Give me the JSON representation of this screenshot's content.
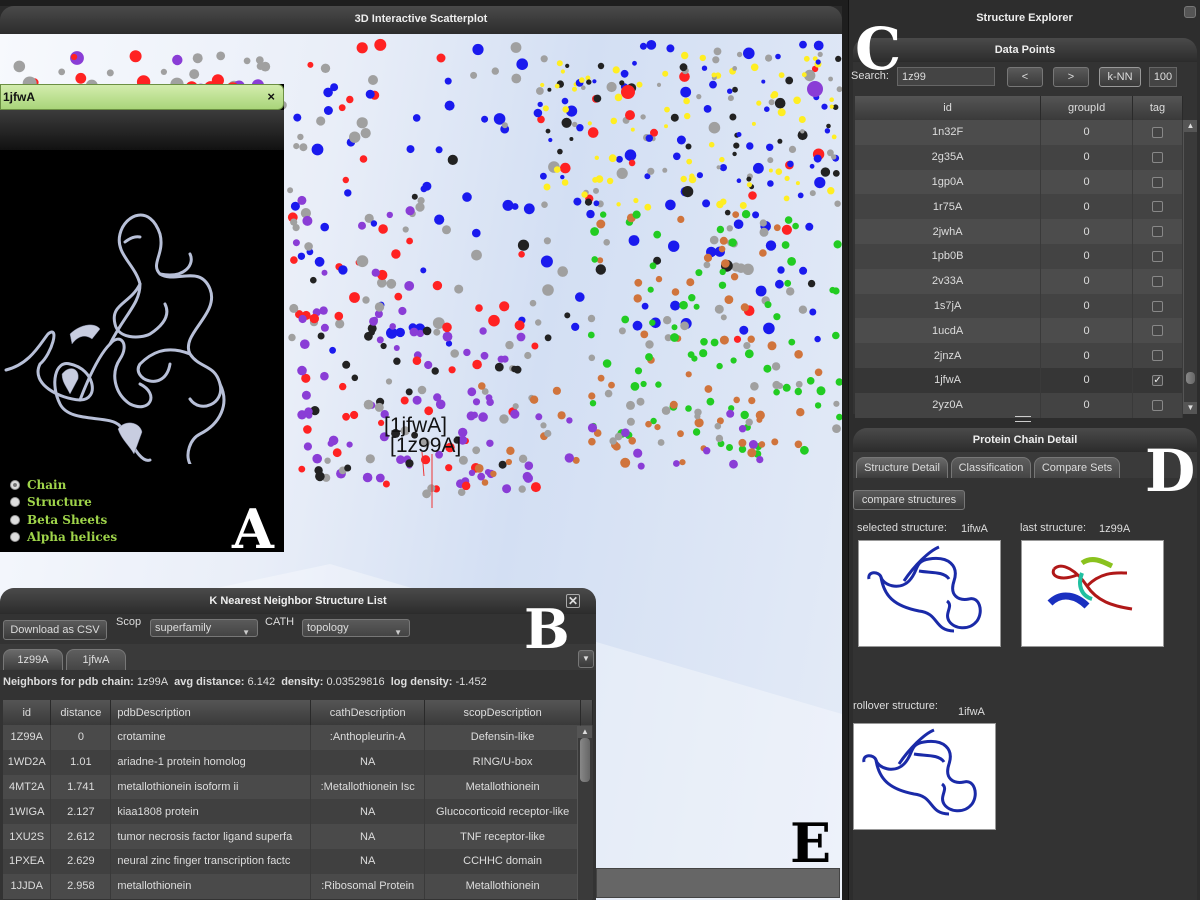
{
  "scatterplot": {
    "title": "3D Interactive Scatterplot",
    "labels": [
      "[1jfwA]",
      "[1z99A]"
    ],
    "point_colors": {
      "red": "#ff2222",
      "blue": "#1a1aee",
      "grey": "#a0a0a0",
      "purple": "#8a3dd6",
      "yellow": "#ffee22",
      "green": "#22cc22",
      "black": "#222222",
      "orange": "#d0743c"
    },
    "panel_letter": "E"
  },
  "viewer": {
    "title": "1jfwA",
    "close": "×",
    "options": [
      "Chain",
      "Structure",
      "Beta Sheets",
      "Alpha helices"
    ],
    "selected_option": "Chain",
    "panel_letter": "A"
  },
  "knn": {
    "title": "K Nearest Neighbor Structure List",
    "close": "✕",
    "download_label": "Download as CSV",
    "scop_label": "Scop",
    "scop_value": "superfamily",
    "cath_label": "CATH",
    "cath_value": "topology",
    "tabs": [
      "1z99A",
      "1jfwA"
    ],
    "info": {
      "neighbors_label": "Neighbors for pdb chain:",
      "chain": "1z99A",
      "avg_label": "avg distance:",
      "avg": "6.142",
      "density_label": "density:",
      "density": "0.03529816",
      "logdensity_label": "log density:",
      "logdensity": "-1.452"
    },
    "columns": [
      "id",
      "distance",
      "pdbDescription",
      "cathDescription",
      "scopDescription"
    ],
    "rows": [
      [
        "1Z99A",
        "0",
        "crotamine",
        ":Anthopleurin-A",
        "Defensin-like"
      ],
      [
        "1WD2A",
        "1.01",
        "ariadne-1 protein homolog",
        "NA",
        "RING/U-box"
      ],
      [
        "4MT2A",
        "1.741",
        "metallothionein isoform ii",
        ":Metallothionein Isc",
        "Metallothionein"
      ],
      [
        "1WIGA",
        "2.127",
        "kiaa1808 protein",
        "NA",
        "Glucocorticoid receptor-like"
      ],
      [
        "1XU2S",
        "2.612",
        "tumor necrosis factor ligand superfa",
        "NA",
        "TNF receptor-like"
      ],
      [
        "1PXEA",
        "2.629",
        "neural zinc finger transcription factc",
        "NA",
        "CCHHC domain"
      ],
      [
        "1JJDA",
        "2.958",
        "metallothionein",
        ":Ribosomal Protein",
        "Metallothionein"
      ]
    ],
    "panel_letter": "B"
  },
  "explorer": {
    "title": "Structure Explorer",
    "data_points": {
      "title": "Data Points",
      "search_label": "Search:",
      "search_value": "1z99",
      "prev": "<",
      "next": ">",
      "knn_button": "k-NN",
      "k_value": "100",
      "columns": [
        "id",
        "groupId",
        "tag"
      ],
      "rows": [
        {
          "id": "1n32F",
          "group": "0",
          "tag": false
        },
        {
          "id": "2g35A",
          "group": "0",
          "tag": false
        },
        {
          "id": "1gp0A",
          "group": "0",
          "tag": false
        },
        {
          "id": "1r75A",
          "group": "0",
          "tag": false
        },
        {
          "id": "2jwhA",
          "group": "0",
          "tag": false
        },
        {
          "id": "1pb0B",
          "group": "0",
          "tag": false
        },
        {
          "id": "2v33A",
          "group": "0",
          "tag": false
        },
        {
          "id": "1s7jA",
          "group": "0",
          "tag": false
        },
        {
          "id": "1ucdA",
          "group": "0",
          "tag": false
        },
        {
          "id": "2jnzA",
          "group": "0",
          "tag": false
        },
        {
          "id": "1jfwA",
          "group": "0",
          "tag": true
        },
        {
          "id": "2yz0A",
          "group": "0",
          "tag": false
        }
      ],
      "panel_letter": "C"
    },
    "detail": {
      "title": "Protein Chain Detail",
      "tabs": [
        "Structure Detail",
        "Classification",
        "Compare Sets"
      ],
      "compare_button": "compare structures",
      "selected_label": "selected structure:",
      "selected_value": "1ifwA",
      "last_label": "last structure:",
      "last_value": "1z99A",
      "rollover_label": "rollover structure:",
      "rollover_value": "1ifwA",
      "panel_letter": "D"
    }
  }
}
